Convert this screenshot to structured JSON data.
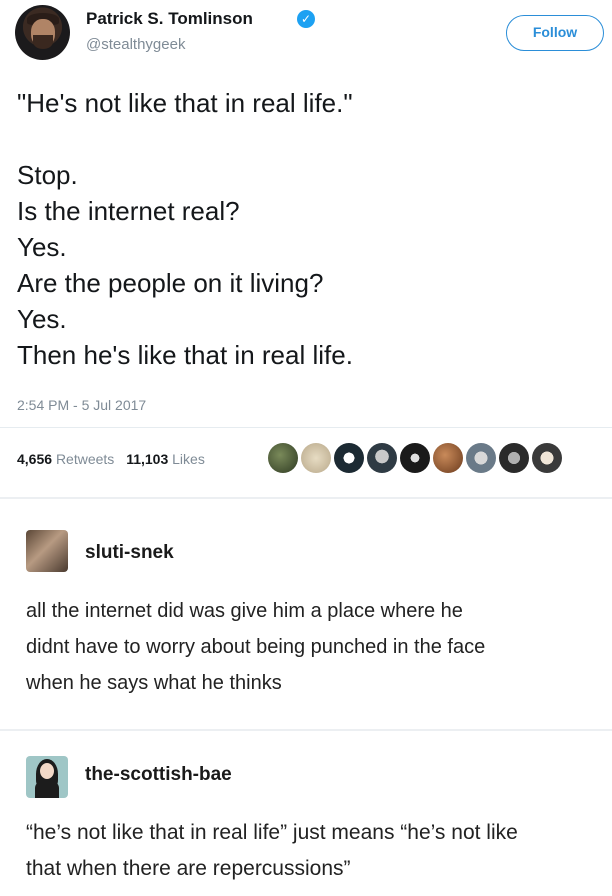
{
  "tweet": {
    "author_name": "Patrick S. Tomlinson",
    "verified_icon": "verified-badge-icon",
    "handle": "@stealthygeek",
    "follow_label": "Follow",
    "text_lines": [
      "\"He's not like that in real life.\"",
      "",
      "Stop.",
      "Is the internet real?",
      "Yes.",
      "Are the people on it living?",
      "Yes.",
      "Then he's like that in real life."
    ],
    "timestamp": "2:54 PM - 5 Jul 2017",
    "retweets_count": "4,656",
    "retweets_label": "Retweets",
    "likes_count": "11,103",
    "likes_label": "Likes"
  },
  "replies": [
    {
      "username": "sluti-snek",
      "text_lines": [
        "all the internet did was give him a place where he",
        "didnt have to worry about being punched in the face",
        "when he says what he thinks"
      ]
    },
    {
      "username": "the-scottish-bae",
      "text_lines": [
        "“he’s not like that in real life” just means “he’s not like",
        "that when there are repercussions”"
      ]
    }
  ],
  "colors": {
    "accent": "#1da1f2",
    "follow": "#2b8ed8",
    "muted": "#7f8b96"
  }
}
